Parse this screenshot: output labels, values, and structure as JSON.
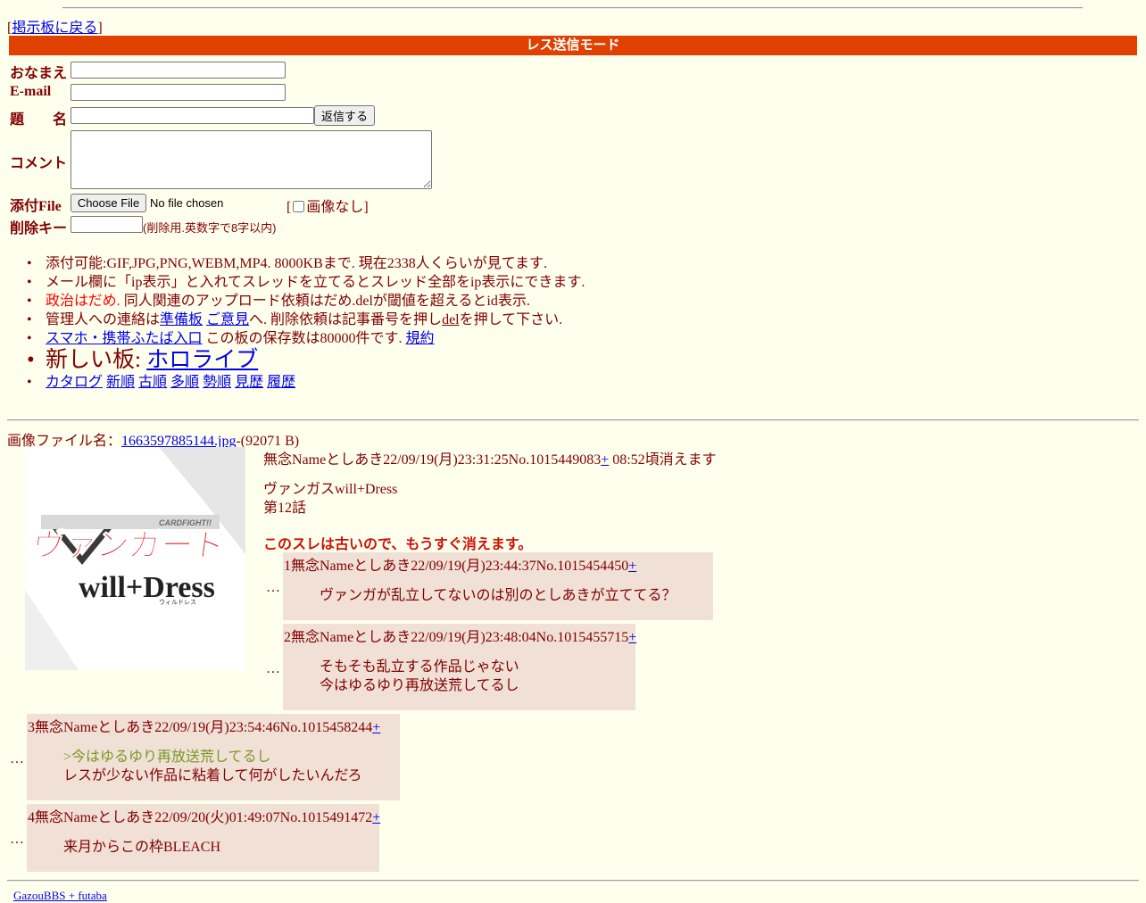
{
  "nav": {
    "back_link": "掲示板に戻る"
  },
  "form": {
    "mode_title": "レス送信モード",
    "labels": {
      "name": "おなまえ",
      "email": "E-mail",
      "subject": "題　　名",
      "comment": "コメント",
      "file": "添付File",
      "delkey": "削除キー"
    },
    "submit_label": "返信する",
    "file_button": "Choose File",
    "file_status": "No file chosen",
    "no_image_label": "画像なし",
    "delkey_note": "(削除用.英数字で8字以内)"
  },
  "info": {
    "line1": "添付可能:GIF,JPG,PNG,WEBM,MP4. 8000KBまで. 現在2338人くらいが見てます.",
    "line2": "メール欄に「ip表示」と入れてスレッドを立てるとスレッド全部をip表示にできます.",
    "line3_red": "政治はだめ.",
    "line3_rest": " 同人関連のアップロード依頼はだめ.delが閾値を超えるとid表示.",
    "line4_a": "管理人への連絡は",
    "line4_link1": "準備板",
    "line4_link2": "ご意見",
    "line4_b": "へ. 削除依頼は記事番号を押し",
    "line4_del": "del",
    "line4_c": "を押して下さい.",
    "line5_link": "スマホ・携帯ふたば入口",
    "line5_text": " この板の保存数は80000件です. ",
    "line5_rules": "規約",
    "new_board_text": "新しい板: ",
    "new_board_link": "ホロライブ",
    "sort_links": [
      "カタログ",
      "新順",
      "古順",
      "多順",
      "勢順",
      "見歴",
      "履歴"
    ]
  },
  "thread": {
    "file_label": "画像ファイル名：",
    "file_name": "1663597885144.jpg",
    "file_size": "-(92071 B)",
    "thumb_logo_top": "CARDFIGHT!!",
    "thumb_logo_main": "ヴァンガード",
    "thumb_logo_sub": "will+Dress",
    "thumb_logo_kana": "ウィルドレス",
    "op": {
      "header": "無念Nameとしあき22/09/19(月)23:31:25No.1015449083",
      "plus": "+",
      "expire": " 08:52頃消えます",
      "body_line1": "ヴァンガスwill+Dress",
      "body_line2": "第12話"
    },
    "old_notice": "このスレは古いので、もうすぐ消えます。",
    "dots": "…",
    "replies": [
      {
        "header": "1無念Nameとしあき22/09/19(月)23:44:37No.1015454450",
        "plus": "+",
        "lines": [
          "ヴァンガが乱立してないのは別のとしあきが立ててる？"
        ]
      },
      {
        "header": "2無念Nameとしあき22/09/19(月)23:48:04No.1015455715",
        "plus": "+",
        "lines": [
          "そもそも乱立する作品じゃない",
          "今はゆるゆり再放送荒してるし"
        ]
      },
      {
        "header": "3無念Nameとしあき22/09/19(月)23:54:46No.1015458244",
        "plus": "+",
        "quote": ">今はゆるゆり再放送荒してるし",
        "lines": [
          "レスが少ない作品に粘着して何がしたいんだろ"
        ]
      },
      {
        "header": "4無念Nameとしあき22/09/20(火)01:49:07No.1015491472",
        "plus": "+",
        "lines": [
          "来月からこの枠BLEACH"
        ]
      }
    ]
  },
  "footer": {
    "text": "GazouBBS + futaba"
  }
}
